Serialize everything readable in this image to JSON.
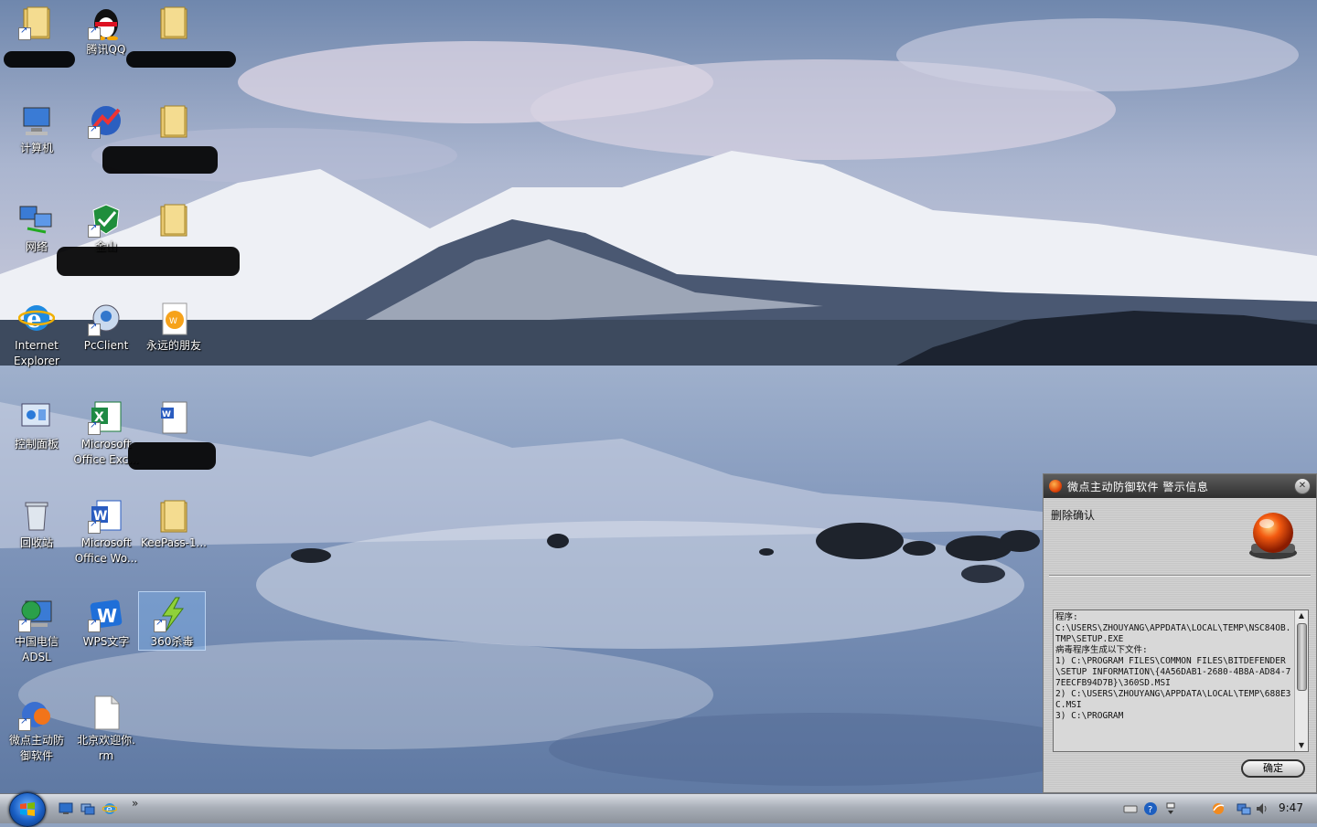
{
  "desktop": {
    "icons": [
      {
        "label": "",
        "name": "folder-icon"
      },
      {
        "label": "腾讯QQ",
        "name": "qq-penguin-icon"
      },
      {
        "label": "",
        "name": "folder-icon"
      },
      {
        "label": "计算机",
        "name": "computer-icon"
      },
      {
        "label": "",
        "name": "chart-app-icon"
      },
      {
        "label": "",
        "name": "folder-icon"
      },
      {
        "label": "网络",
        "name": "network-icon"
      },
      {
        "label": "金山",
        "name": "kingsoft-security-icon"
      },
      {
        "label": "",
        "name": "folder-icon"
      },
      {
        "label": "Internet\nExplorer",
        "name": "internet-explorer-icon"
      },
      {
        "label": "PcClient",
        "name": "pcclient-icon"
      },
      {
        "label": "永远的朋友",
        "name": "media-file-icon"
      },
      {
        "label": "控制面板",
        "name": "control-panel-icon"
      },
      {
        "label": "Microsoft\nOffice Exc...",
        "name": "excel-icon"
      },
      {
        "label": "",
        "name": "word-document-icon"
      },
      {
        "label": "回收站",
        "name": "recycle-bin-icon"
      },
      {
        "label": "Microsoft\nOffice Wo...",
        "name": "word-icon"
      },
      {
        "label": "KeePass-1...",
        "name": "folder-icon"
      },
      {
        "label": "中国电信\nADSL",
        "name": "adsl-globe-icon"
      },
      {
        "label": "WPS文字",
        "name": "wps-writer-icon"
      },
      {
        "label": "360杀毒",
        "name": "360-antivirus-icon"
      },
      {
        "label": "微点主动防\n御软件",
        "name": "micropoint-icon"
      },
      {
        "label": "北京欢迎你.\nrm",
        "name": "file-icon"
      }
    ]
  },
  "dialog": {
    "title": "微点主动防御软件   警示信息",
    "close_label": "✕",
    "heading": "删除确认",
    "message": "程序:\nC:\\USERS\\ZHOUYANG\\APPDATA\\LOCAL\\TEMP\\NSC84OB.TMP\\SETUP.EXE\n病毒程序生成以下文件:\n1) C:\\PROGRAM FILES\\COMMON FILES\\BITDEFENDER\\SETUP INFORMATION\\{4A56DAB1-2680-4B8A-AD84-77EECFB94D7B}\\360SD.MSI\n2) C:\\USERS\\ZHOUYANG\\APPDATA\\LOCAL\\TEMP\\688E3C.MSI\n3) C:\\PROGRAM",
    "ok_label": "确定",
    "colors": {
      "titlebar": "#3f3f3f",
      "alarm": "#e0470a"
    }
  },
  "taskbar": {
    "quicklaunch_more": "»",
    "quicklaunch": [
      "show-desktop-icon",
      "switch-windows-icon",
      "ie-quicklaunch-icon"
    ],
    "tray": [
      "keyboard-icon",
      "help-icon",
      "expand-tray-icon",
      "tray-app-icon",
      "network-tray-icon",
      "volume-icon"
    ],
    "clock": "9:47"
  }
}
